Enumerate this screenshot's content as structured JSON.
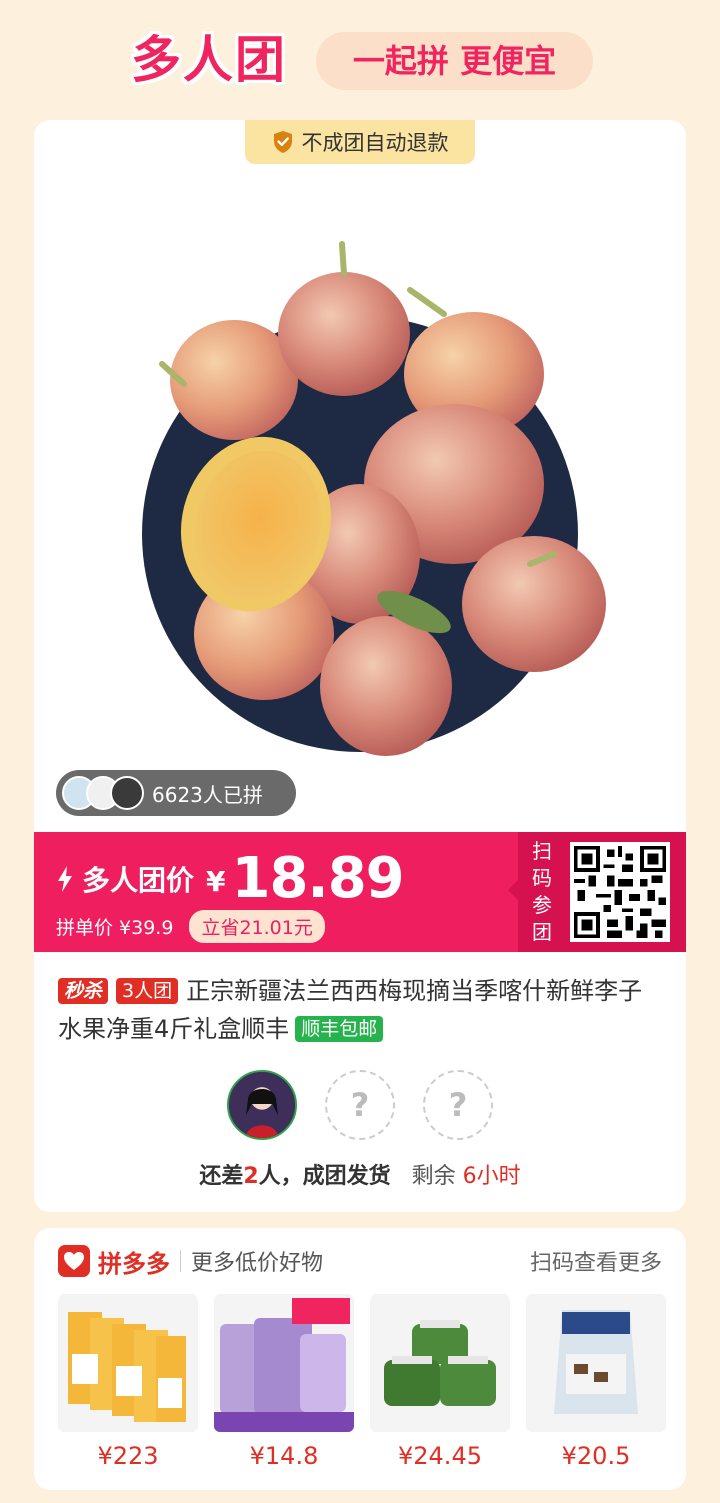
{
  "header": {
    "brand": "多人团",
    "slogan": "一起拼 更便宜"
  },
  "badge": {
    "refund": "不成团自动退款",
    "icon": "shield-check-icon"
  },
  "buyers": {
    "count_text": "6623人已拼"
  },
  "price": {
    "group_label": "多人团价",
    "currency": "¥",
    "group_price": "18.89",
    "single_label": "拼单价 ¥39.9",
    "save_label": "立省21.01元",
    "qr_label": "扫码参团"
  },
  "product": {
    "tag_flash": "秒杀",
    "tag_group": "3人团",
    "title": "正宗新疆法兰西西梅现摘当季喀什新鲜李子水果净重4斤礼盒顺丰",
    "tag_shipping": "顺丰包邮"
  },
  "group_status": {
    "prefix": "还差",
    "missing": "2",
    "suffix": "人，成团发货",
    "remain_label": "剩余",
    "remain_time": "6小时",
    "empty_slot": "?"
  },
  "more": {
    "brand": "拼多多",
    "subtitle": "更多低价好物",
    "scan_label": "扫码查看更多",
    "goods": [
      {
        "price": "¥223"
      },
      {
        "price": "¥14.8"
      },
      {
        "price": "¥24.45"
      },
      {
        "price": "¥20.5"
      }
    ]
  },
  "colors": {
    "accent": "#ee1e5f",
    "price_red": "#e02e24",
    "green": "#26b34d",
    "bg": "#fdf0dd"
  }
}
